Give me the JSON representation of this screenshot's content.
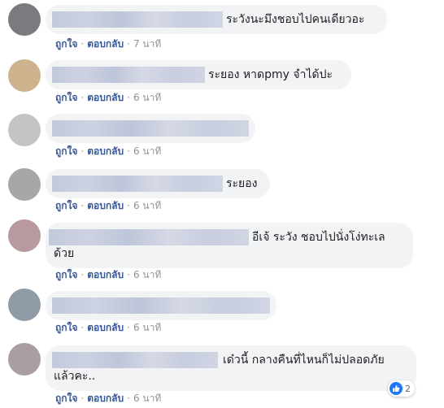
{
  "comments": [
    {
      "text": "ระวังนะมึงชอบไปคนเดียวอะ",
      "text_line2": "",
      "like": "ถูกใจ",
      "reply": "ตอบกลับ",
      "time": "7 นาที",
      "avatar_color": "#7a7a80"
    },
    {
      "text": "ระยอง หาดpmy จำได้ปะ",
      "text_line2": "",
      "like": "ถูกใจ",
      "reply": "ตอบกลับ",
      "time": "6 นาที",
      "avatar_color": "#cdb48e"
    },
    {
      "text": "",
      "text_line2": "",
      "like": "ถูกใจ",
      "reply": "ตอบกลับ",
      "time": "6 นาที",
      "avatar_color": "#c4c4c4"
    },
    {
      "text": "ระยอง",
      "text_line2": "",
      "like": "ถูกใจ",
      "reply": "ตอบกลับ",
      "time": "6 นาที",
      "avatar_color": "#a9a6a8"
    },
    {
      "text": "อีเจ้ ระวัง ชอบไปนั่งโง่ทะเล",
      "text_line2": "ด้วย",
      "like": "ถูกใจ",
      "reply": "ตอบกลับ",
      "time": "6 นาที",
      "avatar_color": "#b89a9e"
    },
    {
      "text": "",
      "text_line2": "",
      "like": "ถูกใจ",
      "reply": "ตอบกลับ",
      "time": "6 นาที",
      "avatar_color": "#909ba8"
    },
    {
      "text": "เด๋วนี้ กลางคืนที่ไหนก็ไม่ปลอดภัย",
      "text_line2": "แล้วคะ..",
      "like": "ถูกใจ",
      "reply": "ตอบกลับ",
      "time": "6 นาที",
      "avatar_color": "#a89ea4",
      "reaction_count": "2"
    }
  ],
  "separator": "·",
  "colors": {
    "link": "#385898",
    "bubble": "#f2f3f5",
    "like_blue": "#2078f4"
  }
}
